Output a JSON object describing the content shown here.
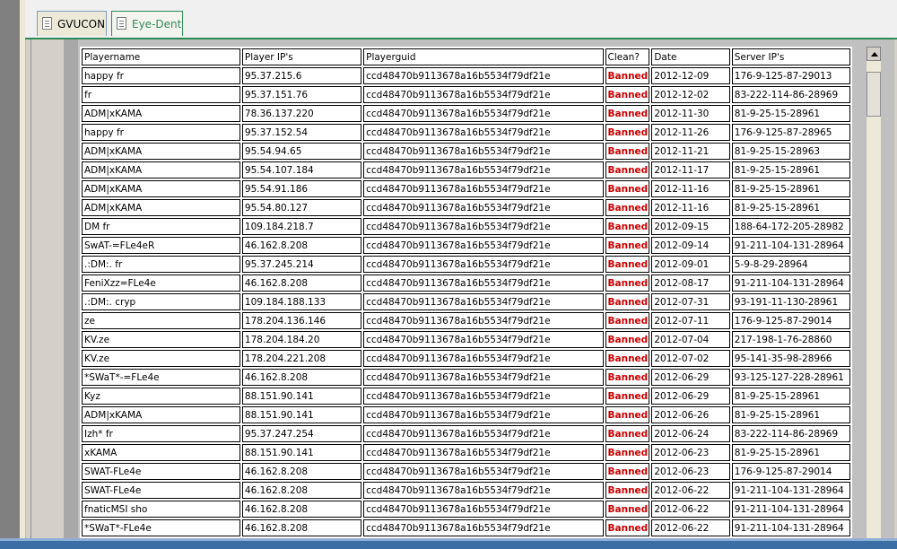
{
  "tabs": [
    {
      "label": "GVUCON"
    },
    {
      "label": "Eye-Dent"
    }
  ],
  "table": {
    "headers": [
      "Playername",
      "Player IP's",
      "Playerguid",
      "Clean?",
      "Date",
      "Server IP's"
    ],
    "rows": [
      [
        "happy fr",
        "95.37.215.6",
        "ccd48470b9113678a16b5534f79df21e",
        "Banned",
        "2012-12-09",
        "176-9-125-87-29013"
      ],
      [
        "fr",
        "95.37.151.76",
        "ccd48470b9113678a16b5534f79df21e",
        "Banned",
        "2012-12-02",
        "83-222-114-86-28969"
      ],
      [
        "ADM|xKAMA",
        "78.36.137.220",
        "ccd48470b9113678a16b5534f79df21e",
        "Banned",
        "2012-11-30",
        "81-9-25-15-28961"
      ],
      [
        "happy fr",
        "95.37.152.54",
        "ccd48470b9113678a16b5534f79df21e",
        "Banned",
        "2012-11-26",
        "176-9-125-87-28965"
      ],
      [
        "ADM|xKAMA",
        "95.54.94.65",
        "ccd48470b9113678a16b5534f79df21e",
        "Banned",
        "2012-11-21",
        "81-9-25-15-28963"
      ],
      [
        "ADM|xKAMA",
        "95.54.107.184",
        "ccd48470b9113678a16b5534f79df21e",
        "Banned",
        "2012-11-17",
        "81-9-25-15-28961"
      ],
      [
        "ADM|xKAMA",
        "95.54.91.186",
        "ccd48470b9113678a16b5534f79df21e",
        "Banned",
        "2012-11-16",
        "81-9-25-15-28961"
      ],
      [
        "ADM|xKAMA",
        "95.54.80.127",
        "ccd48470b9113678a16b5534f79df21e",
        "Banned",
        "2012-11-16",
        "81-9-25-15-28961"
      ],
      [
        "DM fr",
        "109.184.218.7",
        "ccd48470b9113678a16b5534f79df21e",
        "Banned",
        "2012-09-15",
        "188-64-172-205-28982"
      ],
      [
        "SwAT-=FLe4eR",
        "46.162.8.208",
        "ccd48470b9113678a16b5534f79df21e",
        "Banned",
        "2012-09-14",
        "91-211-104-131-28964"
      ],
      [
        ".:DM:. fr",
        "95.37.245.214",
        "ccd48470b9113678a16b5534f79df21e",
        "Banned",
        "2012-09-01",
        "5-9-8-29-28964"
      ],
      [
        "FeniXzz=FLe4e",
        "46.162.8.208",
        "ccd48470b9113678a16b5534f79df21e",
        "Banned",
        "2012-08-17",
        "91-211-104-131-28964"
      ],
      [
        ".:DM:. cryp",
        "109.184.188.133",
        "ccd48470b9113678a16b5534f79df21e",
        "Banned",
        "2012-07-31",
        "93-191-11-130-28961"
      ],
      [
        "ze",
        "178.204.136.146",
        "ccd48470b9113678a16b5534f79df21e",
        "Banned",
        "2012-07-11",
        "176-9-125-87-29014"
      ],
      [
        "KV.ze",
        "178.204.184.20",
        "ccd48470b9113678a16b5534f79df21e",
        "Banned",
        "2012-07-04",
        "217-198-1-76-28860"
      ],
      [
        "KV.ze",
        "178.204.221.208",
        "ccd48470b9113678a16b5534f79df21e",
        "Banned",
        "2012-07-02",
        "95-141-35-98-28966"
      ],
      [
        "*SWaT*-=FLe4e",
        "46.162.8.208",
        "ccd48470b9113678a16b5534f79df21e",
        "Banned",
        "2012-06-29",
        "93-125-127-228-28961"
      ],
      [
        "Kyz",
        "88.151.90.141",
        "ccd48470b9113678a16b5534f79df21e",
        "Banned",
        "2012-06-29",
        "81-9-25-15-28961"
      ],
      [
        "ADM|xKAMA",
        "88.151.90.141",
        "ccd48470b9113678a16b5534f79df21e",
        "Banned",
        "2012-06-26",
        "81-9-25-15-28961"
      ],
      [
        "Izh* fr",
        "95.37.247.254",
        "ccd48470b9113678a16b5534f79df21e",
        "Banned",
        "2012-06-24",
        "83-222-114-86-28969"
      ],
      [
        "xKAMA",
        "88.151.90.141",
        "ccd48470b9113678a16b5534f79df21e",
        "Banned",
        "2012-06-23",
        "81-9-25-15-28961"
      ],
      [
        "SWAT-FLe4e",
        "46.162.8.208",
        "ccd48470b9113678a16b5534f79df21e",
        "Banned",
        "2012-06-23",
        "176-9-125-87-29014"
      ],
      [
        "SWAT-FLe4e",
        "46.162.8.208",
        "ccd48470b9113678a16b5534f79df21e",
        "Banned",
        "2012-06-22",
        "91-211-104-131-28964"
      ],
      [
        "fnaticMSI sho",
        "46.162.8.208",
        "ccd48470b9113678a16b5534f79df21e",
        "Banned",
        "2012-06-22",
        "91-211-104-131-28964"
      ],
      [
        "*SWaT*-FLe4e",
        "46.162.8.208",
        "ccd48470b9113678a16b5534f79df21e",
        "Banned",
        "2012-06-22",
        "91-211-104-131-28964"
      ]
    ]
  },
  "colors": {
    "banned": "#cc0000",
    "active_tab": "#2e8b57"
  }
}
